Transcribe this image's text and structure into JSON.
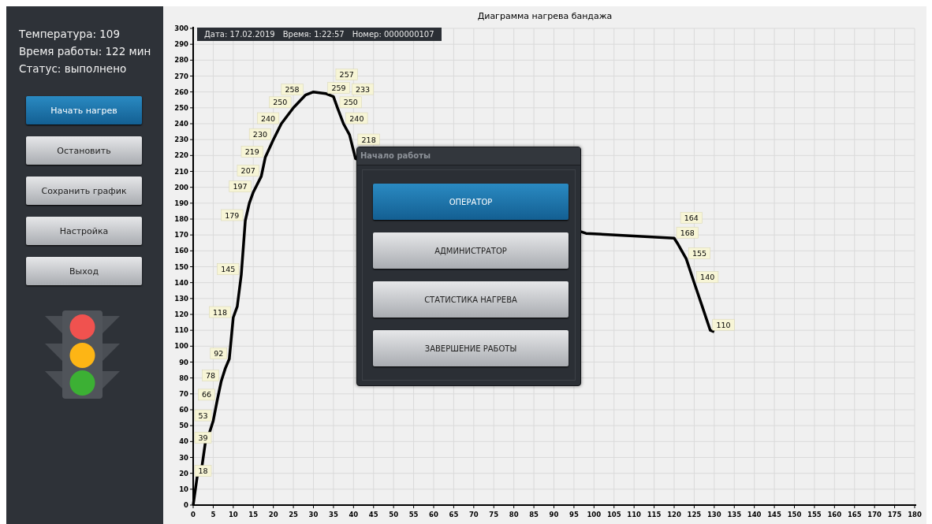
{
  "sidebar": {
    "readouts": [
      "Температура: 109",
      "Время работы: 122 мин",
      "Статус: выполнено"
    ],
    "buttons": [
      {
        "label": "Начать нагрев",
        "selected": true
      },
      {
        "label": "Остановить",
        "selected": false
      },
      {
        "label": "Сохранить график",
        "selected": false
      },
      {
        "label": "Настройка",
        "selected": false
      },
      {
        "label": "Выход",
        "selected": false
      }
    ]
  },
  "chart": {
    "info": [
      "Дата: 17.02.2019",
      "Время: 1:22:57",
      "Номер: 0000000107"
    ],
    "chart_data": {
      "type": "line",
      "title": "Диаграмма нагрева бандажа",
      "x": [
        0,
        1,
        2,
        3,
        4,
        5,
        6,
        7,
        8,
        9,
        10,
        11,
        12,
        13,
        14,
        15,
        17,
        18,
        20,
        22,
        25,
        28,
        30,
        33,
        35,
        36,
        37.5,
        39,
        40.5,
        98,
        120,
        121,
        123,
        125,
        127,
        129,
        130
      ],
      "series": [
        {
          "color": "#000000",
          "values": [
            0,
            18,
            21,
            39,
            45,
            53,
            66,
            78,
            86,
            92,
            118,
            125,
            145,
            179,
            190,
            197,
            207,
            219,
            230,
            240,
            250,
            258,
            260,
            259,
            257,
            250,
            240,
            233,
            218,
            171,
            168,
            164,
            155,
            140,
            125,
            110,
            109
          ]
        }
      ],
      "value_labels": [
        null,
        "18",
        null,
        "39",
        null,
        "53",
        "66",
        "78",
        null,
        "92",
        "118",
        null,
        "145",
        "179",
        null,
        "197",
        "207",
        "219",
        "230",
        "240",
        "250",
        "258",
        null,
        "259",
        "257",
        "250",
        "240",
        "233",
        "218",
        null,
        "168",
        "164",
        "155",
        "140",
        null,
        "110",
        null
      ],
      "grid": true,
      "xlim": [
        0,
        180
      ],
      "ylim": [
        0,
        300
      ],
      "xticks": [
        0,
        5,
        10,
        15,
        20,
        25,
        30,
        35,
        40,
        45,
        50,
        55,
        60,
        65,
        70,
        75,
        80,
        85,
        90,
        95,
        100,
        105,
        110,
        115,
        120,
        125,
        130,
        135,
        140,
        145,
        150,
        155,
        160,
        165,
        170,
        175,
        180
      ],
      "yticks": [
        0,
        10,
        20,
        30,
        40,
        50,
        60,
        70,
        80,
        90,
        100,
        110,
        120,
        130,
        140,
        150,
        160,
        170,
        180,
        190,
        200,
        210,
        220,
        230,
        240,
        250,
        260,
        270,
        280,
        290,
        300
      ]
    }
  },
  "dialog": {
    "title": "Начало работы",
    "buttons": [
      {
        "label": "ОПЕРАТОР",
        "selected": true
      },
      {
        "label": "АДМИНИСТРАТОР",
        "selected": false
      },
      {
        "label": "СТАТИСТИКА НАГРЕВА",
        "selected": false
      },
      {
        "label": "ЗАВЕРШЕНИЕ РАБОТЫ",
        "selected": false
      }
    ]
  }
}
